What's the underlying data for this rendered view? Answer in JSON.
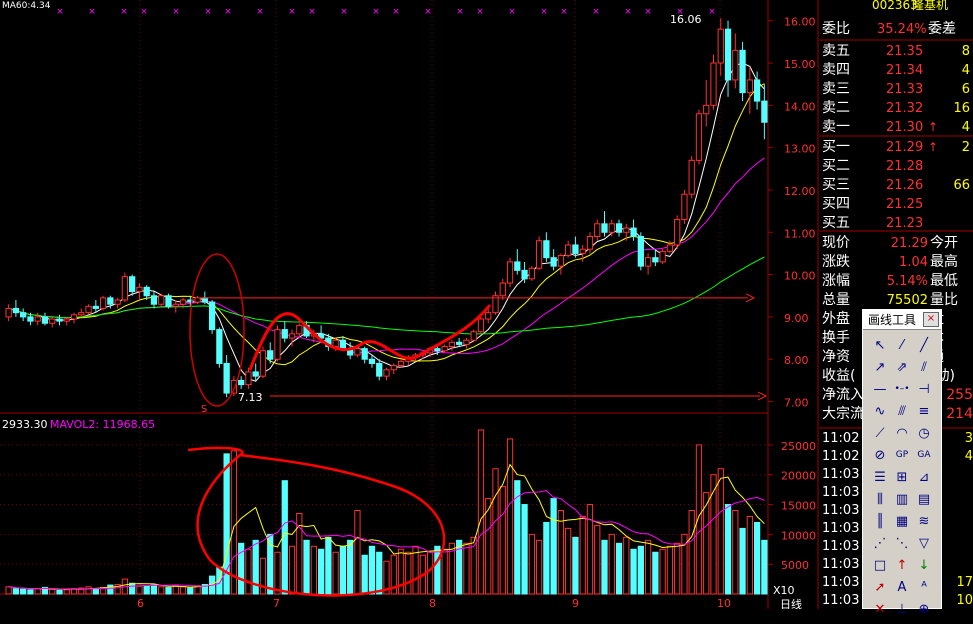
{
  "quote": {
    "stock_code": "002363",
    "stock_name": "隆基机",
    "top_left_label": "MA60:4.34",
    "weibi_label": "委比",
    "weibi_value": "35.24%",
    "weicha_label": "委差",
    "sell": [
      {
        "label": "卖五",
        "price": "21.35",
        "vol": "8"
      },
      {
        "label": "卖四",
        "price": "21.34",
        "vol": "4"
      },
      {
        "label": "卖三",
        "price": "21.33",
        "vol": "6"
      },
      {
        "label": "卖二",
        "price": "21.32",
        "vol": "16"
      },
      {
        "label": "卖一",
        "price": "21.30",
        "vol": "4",
        "arrow": "↑"
      }
    ],
    "buy": [
      {
        "label": "买一",
        "price": "21.29",
        "vol": "2",
        "arrow": "↑"
      },
      {
        "label": "买二",
        "price": "21.28",
        "vol": ""
      },
      {
        "label": "买三",
        "price": "21.26",
        "vol": "66"
      },
      {
        "label": "买四",
        "price": "21.25",
        "vol": ""
      },
      {
        "label": "买五",
        "price": "21.23",
        "vol": ""
      }
    ],
    "stats": [
      {
        "label": "现价",
        "value": "21.29",
        "label2": "今开"
      },
      {
        "label": "涨跌",
        "value": "1.04",
        "label2": "最高"
      },
      {
        "label": "涨幅",
        "value": "5.14%",
        "label2": "最低"
      },
      {
        "label": "总量",
        "value": "75502",
        "label2": "量比"
      },
      {
        "label": "外盘",
        "value": "",
        "label2": "盘"
      },
      {
        "label": "换手",
        "value": "",
        "label2": "本"
      },
      {
        "label": "净资",
        "value": "",
        "label2": "通"
      },
      {
        "label": "收益(",
        "value": "",
        "label2": "(动)"
      },
      {
        "label": "净流入",
        "value": "",
        "label2": "255"
      },
      {
        "label": "大宗流",
        "value": "",
        "label2": "214"
      }
    ],
    "ticks": [
      {
        "time": "11:02",
        "vol": "3"
      },
      {
        "time": "11:02",
        "vol": "4"
      },
      {
        "time": "11:03",
        "vol": ""
      },
      {
        "time": "11:03",
        "vol": ""
      },
      {
        "time": "11:03",
        "vol": ""
      },
      {
        "time": "11:03",
        "vol": ""
      },
      {
        "time": "11:03",
        "vol": ""
      },
      {
        "time": "11:03",
        "vol": ""
      },
      {
        "time": "11:03",
        "vol": "17"
      },
      {
        "time": "11:03",
        "vol": "10"
      },
      {
        "time": "11:03",
        "vol": ""
      }
    ]
  },
  "tool_panel": {
    "title": "画线工具",
    "close": "×",
    "tools": [
      "pointer-icon",
      "line-segment-icon",
      "line-icon",
      "ray-icon",
      "arrow-line-icon",
      "parallel-icon",
      "horizontal-line-icon",
      "dot-line-icon",
      "vertical-marker-icon",
      "wave-icon",
      "parallel-channel-icon",
      "multi-line-icon",
      "diagonal-icon",
      "arc-icon",
      "clock-icon",
      "circle-slash-icon",
      "gp-icon",
      "ga-icon",
      "fib-icon",
      "gann-icon",
      "speed-icon",
      "cycle-icon",
      "bars-icon",
      "boxes-icon",
      "multi-bars-icon",
      "grid-lines-icon",
      "lines-icon",
      "fan-icon",
      "fan2-icon",
      "triangle-icon",
      "rect-icon",
      "up-arrow-icon",
      "down-arrow-icon",
      "red-arrow-icon",
      "text-a-icon",
      "text-a2-icon",
      "x-icon",
      "y-icon",
      "z-icon"
    ]
  },
  "chart_data": [
    {
      "type": "candlestick",
      "panel": "price",
      "ylim": [
        6.8,
        16.3
      ],
      "y_ticks": [
        "16.00",
        "15.00",
        "14.00",
        "13.00",
        "12.00",
        "11.00",
        "10.00",
        "9.00",
        "8.00",
        "7.00"
      ],
      "annotations": {
        "high_label": "16.06",
        "low_label": "7.13",
        "marker": "S"
      },
      "n_bars": 120,
      "ohlc": [
        [
          9.0,
          9.3,
          8.9,
          9.2
        ],
        [
          9.2,
          9.4,
          9.0,
          9.1
        ],
        [
          9.1,
          9.2,
          8.9,
          9.0
        ],
        [
          9.0,
          9.1,
          8.8,
          8.9
        ],
        [
          8.9,
          9.1,
          8.8,
          9.0
        ],
        [
          9.0,
          9.1,
          8.8,
          8.85
        ],
        [
          8.85,
          9.0,
          8.75,
          8.95
        ],
        [
          8.95,
          9.05,
          8.8,
          8.9
        ],
        [
          8.9,
          9.0,
          8.8,
          8.95
        ],
        [
          8.95,
          9.1,
          8.85,
          9.05
        ],
        [
          9.05,
          9.2,
          9.0,
          9.1
        ],
        [
          9.1,
          9.3,
          9.05,
          9.25
        ],
        [
          9.25,
          9.4,
          9.1,
          9.2
        ],
        [
          9.2,
          9.5,
          9.15,
          9.45
        ],
        [
          9.45,
          9.5,
          9.2,
          9.3
        ],
        [
          9.3,
          9.45,
          9.2,
          9.4
        ],
        [
          9.4,
          10.05,
          9.35,
          9.95
        ],
        [
          9.95,
          10.0,
          9.5,
          9.6
        ],
        [
          9.6,
          9.8,
          9.4,
          9.7
        ],
        [
          9.7,
          9.75,
          9.4,
          9.5
        ],
        [
          9.5,
          9.6,
          9.2,
          9.3
        ],
        [
          9.3,
          9.55,
          9.25,
          9.5
        ],
        [
          9.5,
          9.55,
          9.2,
          9.25
        ],
        [
          9.25,
          9.4,
          9.1,
          9.3
        ],
        [
          9.3,
          9.45,
          9.2,
          9.4
        ],
        [
          9.4,
          9.5,
          9.25,
          9.35
        ],
        [
          9.35,
          9.5,
          9.3,
          9.45
        ],
        [
          9.45,
          9.6,
          9.3,
          9.35
        ],
        [
          9.35,
          9.4,
          8.6,
          8.7
        ],
        [
          8.7,
          8.75,
          7.8,
          7.9
        ],
        [
          7.9,
          8.1,
          7.1,
          7.2
        ],
        [
          7.2,
          7.6,
          7.13,
          7.5
        ],
        [
          7.5,
          7.6,
          7.3,
          7.4
        ],
        [
          7.4,
          7.8,
          7.3,
          7.7
        ],
        [
          7.7,
          7.9,
          7.5,
          7.6
        ],
        [
          7.6,
          8.3,
          7.55,
          8.2
        ],
        [
          8.2,
          8.4,
          7.9,
          8.0
        ],
        [
          8.0,
          8.8,
          7.95,
          8.7
        ],
        [
          8.7,
          8.9,
          8.4,
          8.5
        ],
        [
          8.5,
          8.7,
          8.3,
          8.6
        ],
        [
          8.6,
          8.85,
          8.5,
          8.8
        ],
        [
          8.8,
          8.9,
          8.5,
          8.55
        ],
        [
          8.55,
          8.7,
          8.4,
          8.6
        ],
        [
          8.6,
          8.8,
          8.45,
          8.5
        ],
        [
          8.5,
          8.6,
          8.2,
          8.3
        ],
        [
          8.3,
          8.5,
          8.2,
          8.45
        ],
        [
          8.45,
          8.55,
          8.2,
          8.25
        ],
        [
          8.25,
          8.4,
          8.0,
          8.1
        ],
        [
          8.1,
          8.3,
          8.05,
          8.25
        ],
        [
          8.25,
          8.3,
          7.9,
          8.0
        ],
        [
          8.0,
          8.1,
          7.8,
          7.9
        ],
        [
          7.9,
          8.0,
          7.5,
          7.6
        ],
        [
          7.6,
          7.8,
          7.5,
          7.75
        ],
        [
          7.75,
          7.9,
          7.65,
          7.85
        ],
        [
          7.85,
          8.0,
          7.8,
          7.95
        ],
        [
          7.95,
          8.1,
          7.85,
          8.05
        ],
        [
          8.05,
          8.15,
          7.95,
          8.1
        ],
        [
          8.1,
          8.2,
          8.0,
          8.15
        ],
        [
          8.15,
          8.3,
          8.05,
          8.25
        ],
        [
          8.25,
          8.3,
          8.1,
          8.2
        ],
        [
          8.2,
          8.35,
          8.15,
          8.3
        ],
        [
          8.3,
          8.45,
          8.2,
          8.4
        ],
        [
          8.4,
          8.5,
          8.3,
          8.35
        ],
        [
          8.35,
          8.5,
          8.25,
          8.45
        ],
        [
          8.45,
          8.7,
          8.4,
          8.65
        ],
        [
          8.65,
          9.0,
          8.6,
          8.95
        ],
        [
          8.95,
          9.2,
          8.85,
          9.1
        ],
        [
          9.1,
          9.6,
          9.05,
          9.5
        ],
        [
          9.5,
          9.9,
          9.4,
          9.8
        ],
        [
          9.8,
          10.4,
          9.7,
          10.3
        ],
        [
          10.3,
          10.6,
          10.0,
          10.1
        ],
        [
          10.1,
          10.3,
          9.8,
          9.9
        ],
        [
          9.9,
          10.2,
          9.85,
          10.15
        ],
        [
          10.15,
          10.9,
          10.1,
          10.8
        ],
        [
          10.8,
          11.0,
          10.3,
          10.4
        ],
        [
          10.4,
          10.6,
          10.1,
          10.2
        ],
        [
          10.2,
          10.5,
          10.0,
          10.45
        ],
        [
          10.45,
          10.8,
          10.4,
          10.7
        ],
        [
          10.7,
          10.9,
          10.4,
          10.5
        ],
        [
          10.5,
          10.7,
          10.3,
          10.6
        ],
        [
          10.6,
          11.0,
          10.5,
          10.9
        ],
        [
          10.9,
          11.3,
          10.8,
          11.2
        ],
        [
          11.2,
          11.5,
          10.9,
          11.0
        ],
        [
          11.0,
          11.3,
          10.9,
          11.2
        ],
        [
          11.2,
          11.3,
          10.9,
          11.0
        ],
        [
          11.0,
          11.2,
          10.8,
          11.1
        ],
        [
          11.1,
          11.3,
          10.8,
          10.9
        ],
        [
          10.9,
          11.0,
          10.1,
          10.2
        ],
        [
          10.2,
          10.5,
          10.0,
          10.4
        ],
        [
          10.4,
          10.6,
          10.2,
          10.3
        ],
        [
          10.3,
          10.6,
          10.25,
          10.55
        ],
        [
          10.55,
          10.8,
          10.5,
          10.7
        ],
        [
          10.7,
          11.4,
          10.6,
          11.3
        ],
        [
          11.3,
          12.0,
          11.2,
          11.9
        ],
        [
          11.9,
          12.8,
          11.8,
          12.7
        ],
        [
          12.7,
          13.9,
          12.6,
          13.8
        ],
        [
          13.8,
          14.6,
          13.5,
          14.0
        ],
        [
          14.0,
          15.2,
          13.9,
          15.0
        ],
        [
          15.0,
          16.06,
          14.7,
          15.8
        ],
        [
          15.8,
          16.0,
          14.2,
          14.6
        ],
        [
          14.6,
          15.7,
          14.4,
          15.3
        ],
        [
          15.3,
          15.5,
          14.1,
          14.3
        ],
        [
          14.3,
          14.9,
          13.8,
          14.6
        ],
        [
          14.6,
          14.8,
          13.9,
          14.1
        ],
        [
          14.1,
          14.5,
          13.2,
          13.6
        ]
      ],
      "ma_lines": [
        {
          "name": "MA5",
          "color": "#ffffff"
        },
        {
          "name": "MA10",
          "color": "#ffff00"
        },
        {
          "name": "MA20",
          "color": "#ff00ff"
        },
        {
          "name": "MA60",
          "color": "#00ff00"
        }
      ]
    },
    {
      "type": "bar",
      "panel": "volume",
      "title_left": "2933.30",
      "title_label": "MAVOL2: 11968.65",
      "ylim": [
        0,
        28000
      ],
      "y_ticks": [
        "25000",
        "20000",
        "15000",
        "10000",
        "5000"
      ],
      "x_labels": [
        "6",
        "7",
        "8",
        "9",
        "10"
      ],
      "corner_label": "X10",
      "period_label": "日线",
      "values": [
        1200,
        900,
        800,
        700,
        900,
        1100,
        800,
        600,
        700,
        900,
        1000,
        1200,
        900,
        1100,
        1500,
        1600,
        2500,
        1800,
        1300,
        1400,
        1500,
        1200,
        1100,
        1300,
        1200,
        1000,
        1400,
        1600,
        3000,
        4500,
        23500,
        24000,
        8500,
        7500,
        9000,
        6000,
        10000,
        7000,
        19000,
        8000,
        13500,
        9000,
        8000,
        7500,
        9500,
        7000,
        8000,
        9000,
        14000,
        6500,
        8000,
        7000,
        5500,
        6500,
        7500,
        7000,
        8000,
        6500,
        7000,
        8000,
        7500,
        8500,
        9000,
        8500,
        9500,
        27500,
        16000,
        21000,
        18000,
        26000,
        19000,
        15000,
        10000,
        9000,
        12000,
        16000,
        14000,
        11000,
        9500,
        13000,
        15000,
        11500,
        9000,
        10000,
        8500,
        9500,
        7500,
        8000,
        9000,
        7000,
        7500,
        8000,
        8500,
        10000,
        14000,
        25000,
        17000,
        20000,
        21000,
        15000,
        14000,
        11000,
        13000,
        12000,
        9000
      ],
      "colors_hint": "red=up, cyan=down"
    }
  ]
}
